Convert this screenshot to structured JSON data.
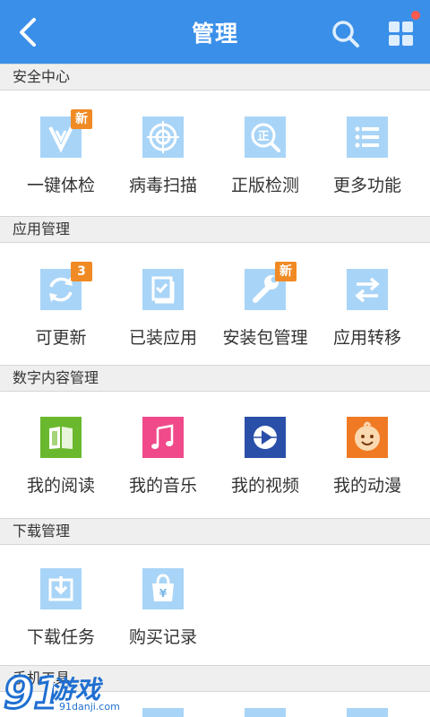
{
  "header": {
    "title": "管理",
    "back_icon": "back-arrow-icon",
    "search_icon": "search-icon",
    "menu_icon": "grid-icon",
    "bar_color": "#3a8fe8"
  },
  "sections": [
    {
      "title": "安全中心",
      "items": [
        {
          "label": "一键体检",
          "icon": "shield-check-icon",
          "badge": "新"
        },
        {
          "label": "病毒扫描",
          "icon": "virus-scan-icon",
          "badge": ""
        },
        {
          "label": "正版检测",
          "icon": "genuine-check-icon",
          "badge": ""
        },
        {
          "label": "更多功能",
          "icon": "list-icon",
          "badge": ""
        }
      ]
    },
    {
      "title": "应用管理",
      "items": [
        {
          "label": "可更新",
          "icon": "refresh-icon",
          "badge": "3"
        },
        {
          "label": "已装应用",
          "icon": "installed-apps-icon",
          "badge": ""
        },
        {
          "label": "安装包管理",
          "icon": "wrench-icon",
          "badge": "新"
        },
        {
          "label": "应用转移",
          "icon": "transfer-icon",
          "badge": ""
        }
      ]
    },
    {
      "title": "数字内容管理",
      "items": [
        {
          "label": "我的阅读",
          "icon": "book-icon",
          "badge": ""
        },
        {
          "label": "我的音乐",
          "icon": "music-note-icon",
          "badge": ""
        },
        {
          "label": "我的视频",
          "icon": "video-play-icon",
          "badge": ""
        },
        {
          "label": "我的动漫",
          "icon": "cartoon-face-icon",
          "badge": ""
        }
      ]
    },
    {
      "title": "下载管理",
      "items": [
        {
          "label": "下载任务",
          "icon": "download-icon",
          "badge": ""
        },
        {
          "label": "购买记录",
          "icon": "shopping-bag-icon",
          "badge": ""
        }
      ]
    },
    {
      "title": "手机工具",
      "items": []
    }
  ],
  "watermark": {
    "text": "游戏",
    "sub": "91danji.com"
  },
  "colors": {
    "accent_blue": "#3a8fe8",
    "badge_orange": "#f08a24",
    "green": "#6ab82e",
    "pink": "#f04a8a",
    "navy": "#2a4fa8",
    "orange": "#f07a24"
  }
}
